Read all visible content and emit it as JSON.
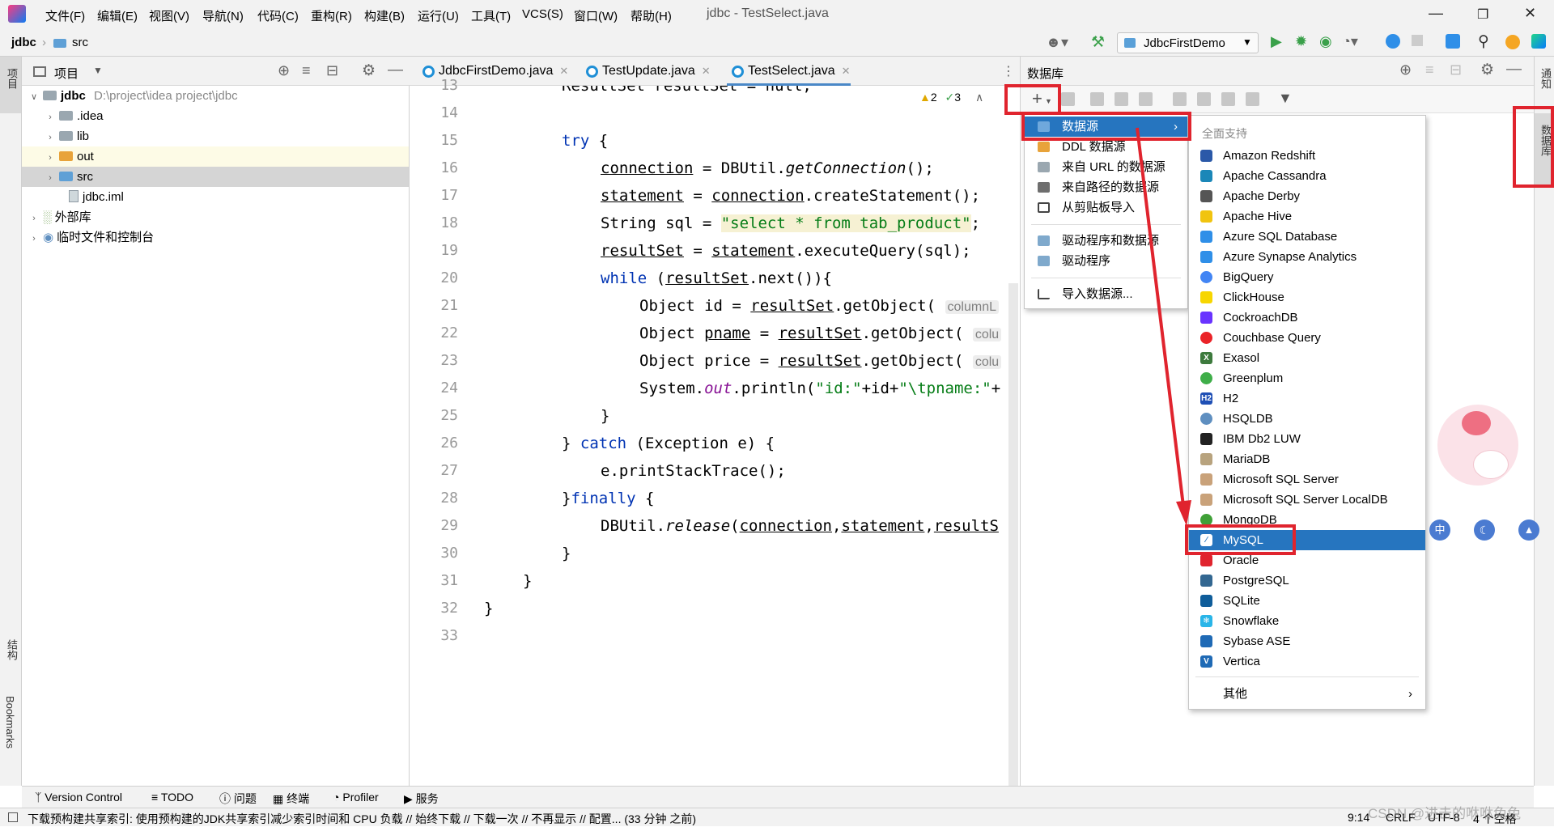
{
  "titlebar": {
    "menus": [
      "文件(F)",
      "编辑(E)",
      "视图(V)",
      "导航(N)",
      "代码(C)",
      "重构(R)",
      "构建(B)",
      "运行(U)",
      "工具(T)",
      "VCS(S)",
      "窗口(W)",
      "帮助(H)"
    ],
    "title": "jdbc - TestSelect.java"
  },
  "navbar": {
    "project": "jdbc",
    "folder": "src",
    "run_config": "JdbcFirstDemo"
  },
  "project_panel": {
    "title": "项目",
    "root_name": "jdbc",
    "root_path": "D:\\project\\idea project\\jdbc",
    "items": [
      ".idea",
      "lib",
      "out",
      "src",
      "jdbc.iml"
    ],
    "external_libs": "外部库",
    "scratches": "临时文件和控制台"
  },
  "editor": {
    "tabs": [
      "JdbcFirstDemo.java",
      "TestUpdate.java",
      "TestSelect.java"
    ],
    "warnings": "2",
    "weak_warnings": "3",
    "line_numbers": [
      "13",
      "14",
      "15",
      "16",
      "17",
      "18",
      "19",
      "20",
      "21",
      "22",
      "23",
      "24",
      "25",
      "26",
      "27",
      "28",
      "29",
      "30",
      "31",
      "32",
      "33"
    ],
    "code": {
      "l13": "ResultSet resultSet = null;",
      "try_kw": "try",
      "brace_open": " {",
      "l16a": "connection",
      "l16b": " = DBUtil.",
      "l16c": "getConnection",
      "l16d": "();",
      "l17a": "statement",
      "l17b": " = ",
      "l17c": "connection",
      "l17d": ".createStatement();",
      "l18a": "String sql = ",
      "l18b": "\"select * from tab_product\"",
      "l18c": ";",
      "l19a": "resultSet",
      "l19b": " = ",
      "l19c": "statement",
      "l19d": ".executeQuery(sql);",
      "while_kw": "while",
      "l20b": " (",
      "l20c": "resultSet",
      "l20d": ".next()){",
      "l21a": "Object id = ",
      "l21b": "resultSet",
      "l21c": ".getObject( ",
      "l21hint": "columnL",
      "l22a": "Object ",
      "l22b": "pname",
      "l22c": " = ",
      "l22d": "resultSet",
      "l22e": ".getObject( ",
      "l22hint": "colu",
      "l23a": "Object price = ",
      "l23b": "resultSet",
      "l23c": ".getObject( ",
      "l23hint": "colu",
      "l24a": "System.",
      "l24b": "out",
      "l24c": ".println(",
      "l24d": "\"id:\"",
      "l24e": "+id+",
      "l24f": "\"\\tpname:\"",
      "l24g": "+",
      "l25": "}",
      "l26a": "} ",
      "catch_kw": "catch",
      "l26c": " (Exception e) {",
      "l27": "e.printStackTrace();",
      "l28a": "}",
      "finally_kw": "finally",
      "l28c": " {",
      "l29a": "DBUtil.",
      "l29b": "release",
      "l29c": "(",
      "l29d": "connection",
      "l29e": ",",
      "l29f": "statement",
      "l29g": ",",
      "l29h": "resultS",
      "l30": "}",
      "l31": "}",
      "l32": "}"
    }
  },
  "db_panel": {
    "title": "数据库",
    "new_menu": {
      "items": [
        "数据源",
        "DDL 数据源",
        "来自 URL 的数据源",
        "来自路径的数据源",
        "从剪贴板导入",
        "驱动程序和数据源",
        "驱动程序",
        "导入数据源..."
      ],
      "selected": "数据源"
    },
    "datasource_menu": {
      "header": "全面支持",
      "items": [
        "Amazon Redshift",
        "Apache Cassandra",
        "Apache Derby",
        "Apache Hive",
        "Azure SQL Database",
        "Azure Synapse Analytics",
        "BigQuery",
        "ClickHouse",
        "CockroachDB",
        "Couchbase Query",
        "Exasol",
        "Greenplum",
        "H2",
        "HSQLDB",
        "IBM Db2 LUW",
        "MariaDB",
        "Microsoft SQL Server",
        "Microsoft SQL Server LocalDB",
        "MongoDB",
        "MySQL",
        "Oracle",
        "PostgreSQL",
        "SQLite",
        "Snowflake",
        "Sybase ASE",
        "Vertica"
      ],
      "selected": "MySQL",
      "other": "其他"
    }
  },
  "side_labels": {
    "left_top": "项目",
    "left_structure": "结构",
    "left_bookmarks": "Bookmarks",
    "right_notify": "通知",
    "right_db": "数据库"
  },
  "bottom_tabs": [
    "Version Control",
    "TODO",
    "问题",
    "终端",
    "Profiler",
    "服务"
  ],
  "status": {
    "message": "下载预构建共享索引: 使用预构建的JDK共享索引减少索引时间和 CPU 负载 // 始终下载 // 下载一次 // 不再显示 // 配置... (33 分钟 之前)",
    "position": "9:14",
    "line_sep": "CRLF",
    "encoding": "UTF-8",
    "indent": "4 个空格",
    "watermark": "CSDN @进击的咻咻兔兔"
  },
  "colors": {
    "accent": "#2675bf",
    "highlight_red": "#e0242e",
    "keyword": "#0033b3",
    "string": "#067d17"
  }
}
